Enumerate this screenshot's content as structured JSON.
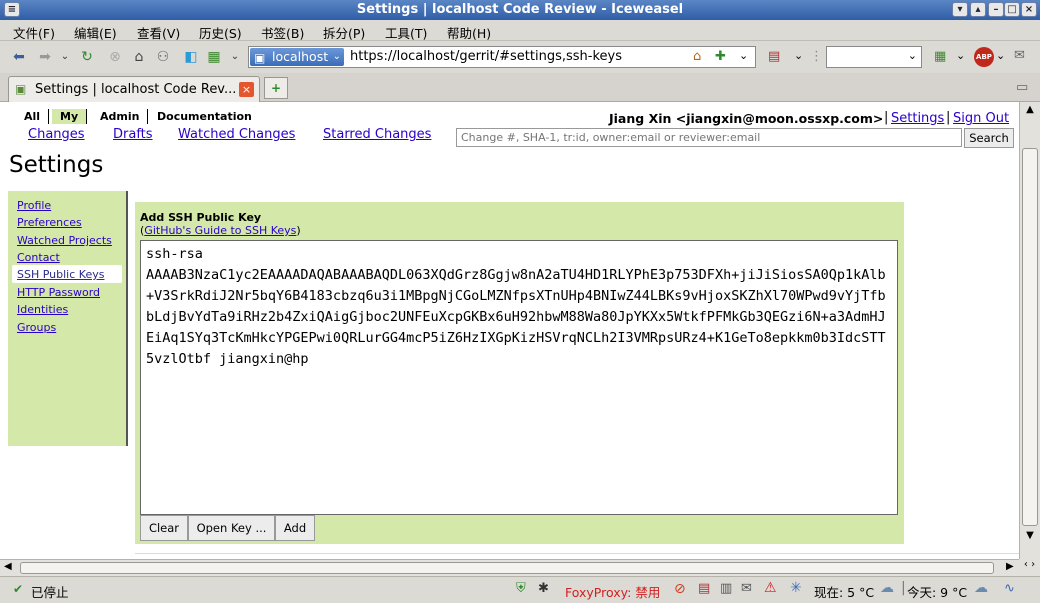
{
  "window": {
    "title": "Settings | localhost Code Review - Iceweasel"
  },
  "menu": [
    "文件(F)",
    "编辑(E)",
    "查看(V)",
    "历史(S)",
    "书签(B)",
    "拆分(P)",
    "工具(T)",
    "帮助(H)"
  ],
  "nav": {
    "site_label": "localhost",
    "url": "https://localhost/gerrit/#settings,ssh-keys"
  },
  "tab": {
    "title": "Settings | localhost Code Rev..."
  },
  "gerrit": {
    "top_menu": [
      "All",
      "My",
      "Admin",
      "Documentation"
    ],
    "selected_top": "My",
    "sub_menu": [
      "Changes",
      "Drafts",
      "Watched Changes",
      "Starred Changes"
    ],
    "user": "Jiang Xin <jiangxin@moon.ossxp.com>",
    "settings_link": "Settings",
    "signout_link": "Sign Out",
    "search_placeholder": "Change #, SHA-1, tr:id, owner:email or reviewer:email",
    "search_button": "Search",
    "page_title": "Settings",
    "left_nav": [
      "Profile",
      "Preferences",
      "Watched Projects",
      "Contact Information",
      "SSH Public Keys",
      "HTTP Password",
      "Identities",
      "Groups"
    ],
    "left_nav_selected": "SSH Public Keys",
    "panel": {
      "heading": "Add SSH Public Key",
      "guide_link": "GitHub's Guide to SSH Keys",
      "key_text": "ssh-rsa\nAAAAB3NzaC1yc2EAAAADAQABAAABAQDL063XQdGrz8Ggjw8nA2aTU4HD1RLYPhE3p753DFXh+jiJiSiosSA0Qp1kAlb+V3SrkRdiJ2Nr5bqY6B4183cbzq6u3i1MBpgNjCGoLMZNfpsXTnUHp4BNIwZ44LBKs9vHjoxSKZhXl70WPwd9vYjTfbbLdjBvYdTa9iRHz2b4ZxiQAigGjboc2UNFEuXcpGKBx6uH92hbwM88Wa80JpYKXx5WtkfPFMkGb3QEGzi6N+a3AdmHJEiAq1SYq3TcKmHkcYPGEPwi0QRLurGG4mcP5iZ6HzIXGpKizHSVrqNCLh2I3VMRpsURz4+K1GeTo8epkkm0b3IdcSTT5vzlOtbf jiangxin@hp",
      "buttons": [
        "Clear",
        "Open Key ...",
        "Add"
      ]
    }
  },
  "status": {
    "left": "已停止",
    "foxyproxy": "FoxyProxy: 禁用",
    "weather_now": "现在: 5 °C",
    "weather_today": "今天: 9 °C"
  }
}
